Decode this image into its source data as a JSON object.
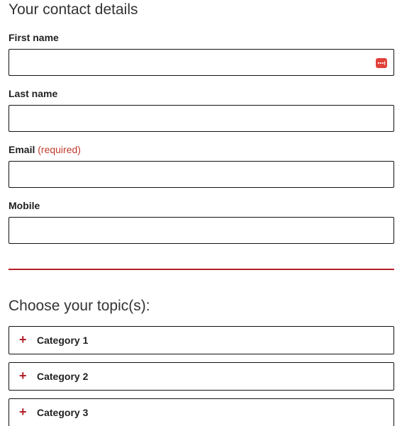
{
  "contact": {
    "heading": "Your contact details",
    "first_name": {
      "label": "First name",
      "value": ""
    },
    "last_name": {
      "label": "Last name",
      "value": ""
    },
    "email": {
      "label": "Email",
      "required_note": "(required)",
      "value": ""
    },
    "mobile": {
      "label": "Mobile",
      "value": ""
    },
    "autofill_icon": "password-manager-icon",
    "colors": {
      "accent": "#b3202a",
      "required": "#c0392b",
      "autofill": "#e0413a",
      "border": "#111111"
    }
  },
  "topics": {
    "heading": "Choose your topic(s):",
    "expand_symbol": "+",
    "categories": [
      {
        "label": "Category 1"
      },
      {
        "label": "Category 2"
      },
      {
        "label": "Category 3"
      }
    ]
  }
}
